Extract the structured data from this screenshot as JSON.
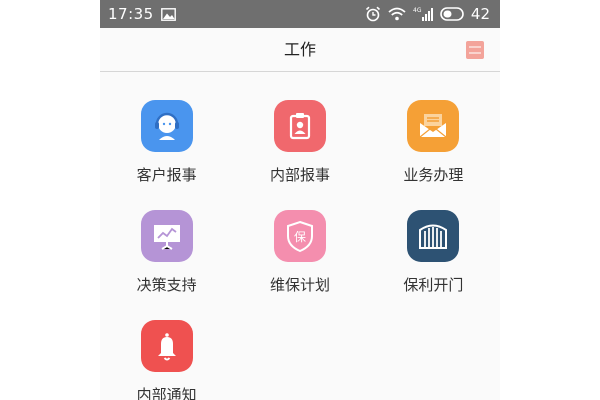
{
  "status_bar": {
    "time": "17:35",
    "left_icons": [
      "image-icon"
    ],
    "right_icons": [
      "alarm-icon",
      "wifi-icon",
      "signal-4g-icon",
      "battery-icon"
    ],
    "network_label": "4G",
    "battery": "42",
    "background": "#6f6f6f"
  },
  "header": {
    "title": "工作",
    "menu_icon": "menu-icon",
    "menu_color": "#f3a39a"
  },
  "apps": [
    {
      "label": "客户报事",
      "icon": "customer-service-icon",
      "color": "#4a95ee"
    },
    {
      "label": "内部报事",
      "icon": "badge-icon",
      "color": "#f0686d"
    },
    {
      "label": "业务办理",
      "icon": "envelope-icon",
      "color": "#f5a036"
    },
    {
      "label": "决策支持",
      "icon": "presentation-chart-icon",
      "color": "#b594d6"
    },
    {
      "label": "维保计划",
      "icon": "shield-icon",
      "color": "#f48eae",
      "icon_text": "保"
    },
    {
      "label": "保利开门",
      "icon": "gate-icon",
      "color": "#2d5273"
    },
    {
      "label": "内部通知",
      "icon": "bell-icon",
      "color": "#ef5150"
    }
  ]
}
